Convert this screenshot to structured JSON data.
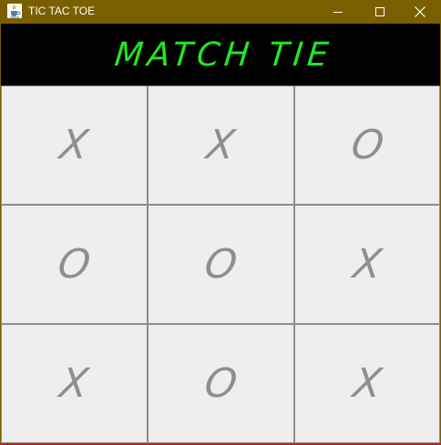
{
  "window": {
    "title": "TIC TAC TOE",
    "icon": "java-cup-icon",
    "title_bar_color": "#7a5f00",
    "controls": {
      "minimize": "minimize-icon",
      "maximize": "maximize-icon",
      "close": "close-icon"
    }
  },
  "status": {
    "text": "MATCH TIE",
    "color": "#22e622",
    "background": "#000000"
  },
  "board": {
    "cells": [
      [
        "X",
        "X",
        "O"
      ],
      [
        "O",
        "O",
        "X"
      ],
      [
        "X",
        "O",
        "X"
      ]
    ],
    "mark_color": "#8f8f8f",
    "cell_background": "#eeeeee"
  }
}
